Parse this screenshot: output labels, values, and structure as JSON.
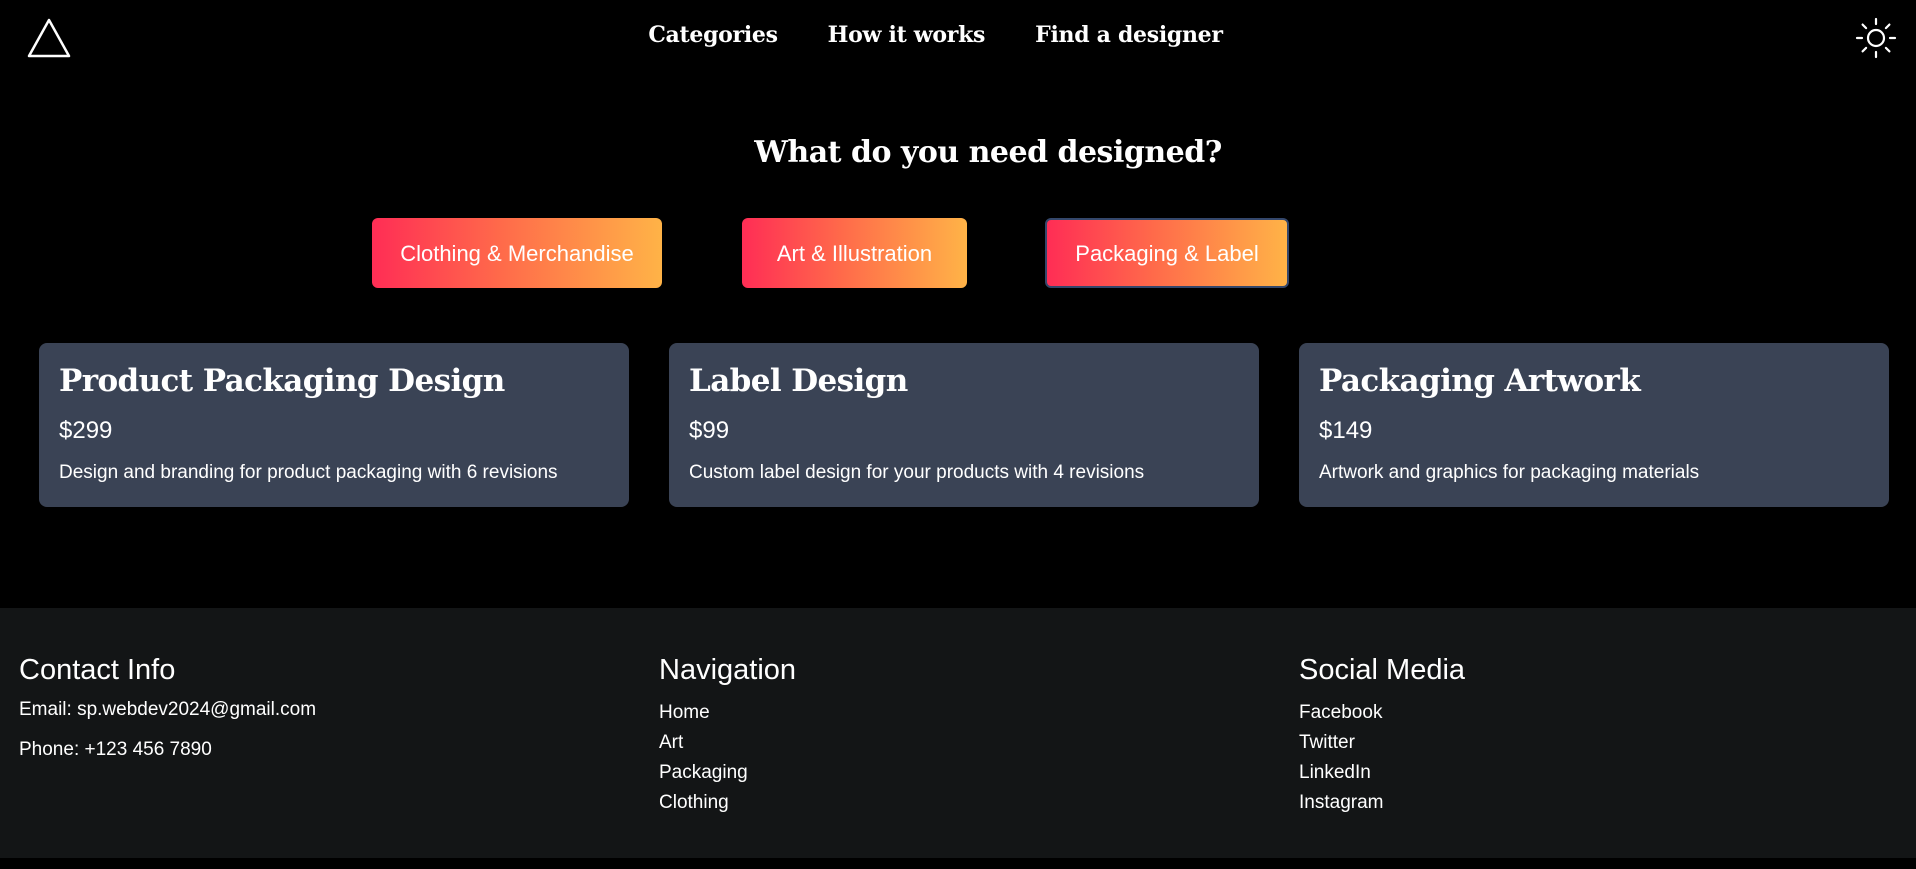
{
  "header": {
    "logo_icon": "triangle-logo-icon",
    "nav": [
      {
        "label": "Categories"
      },
      {
        "label": "How it works"
      },
      {
        "label": "Find a designer"
      }
    ],
    "theme_toggle_icon": "sun-icon"
  },
  "main": {
    "heading": "What do you need designed?",
    "categories": [
      {
        "label": "Clothing & Merchandise",
        "active": false
      },
      {
        "label": "Art & Illustration",
        "active": false
      },
      {
        "label": "Packaging & Label",
        "active": true
      }
    ],
    "services": [
      {
        "title": "Product Packaging Design",
        "price": "$299",
        "description": "Design and branding for product packaging with 6 revisions"
      },
      {
        "title": "Label Design",
        "price": "$99",
        "description": "Custom label design for your products with 4 revisions"
      },
      {
        "title": "Packaging Artwork",
        "price": "$149",
        "description": "Artwork and graphics for packaging materials"
      }
    ]
  },
  "footer": {
    "contact": {
      "heading": "Contact Info",
      "email": "Email: sp.webdev2024@gmail.com",
      "phone": "Phone: +123 456 7890"
    },
    "navigation": {
      "heading": "Navigation",
      "links": [
        "Home",
        "Art",
        "Packaging",
        "Clothing"
      ]
    },
    "social": {
      "heading": "Social Media",
      "links": [
        "Facebook",
        "Twitter",
        "LinkedIn",
        "Instagram"
      ]
    }
  },
  "colors": {
    "background": "#000000",
    "card": "#3a4355",
    "footer": "#131516",
    "gradient_start": "#ff2d55",
    "gradient_end": "#ffb347"
  }
}
